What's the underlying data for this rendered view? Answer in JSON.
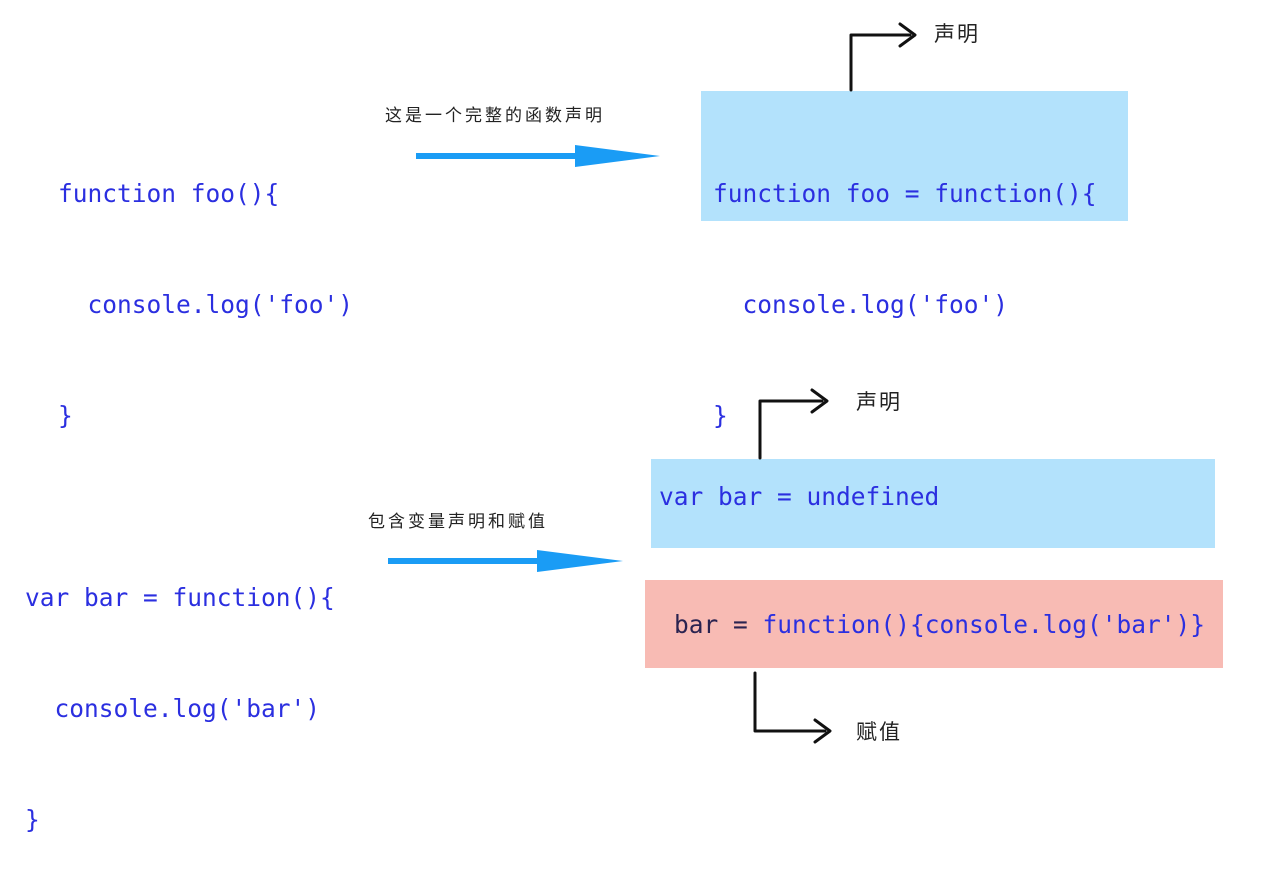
{
  "top": {
    "source_code": [
      "function foo(){",
      "  console.log('foo')",
      "}"
    ],
    "note": "这是一个完整的函数声明",
    "result_code": [
      "function foo = function(){",
      "  console.log('foo')",
      "}"
    ],
    "declaration_label": "声明"
  },
  "bottom": {
    "source_code": [
      "var bar = function(){",
      "  console.log('bar')",
      "}"
    ],
    "note": "包含变量声明和赋值",
    "declaration_code": "var bar = undefined",
    "assignment_target": "bar = ",
    "assignment_value": "function(){console.log('bar')}",
    "declaration_label": "声明",
    "assignment_label": "赋值"
  },
  "colors": {
    "code_text": "#2b2fe0",
    "declaration_box": "#b3e2fc",
    "assignment_box": "#f8bbb4",
    "flow_arrow": "#1a9cf5"
  }
}
